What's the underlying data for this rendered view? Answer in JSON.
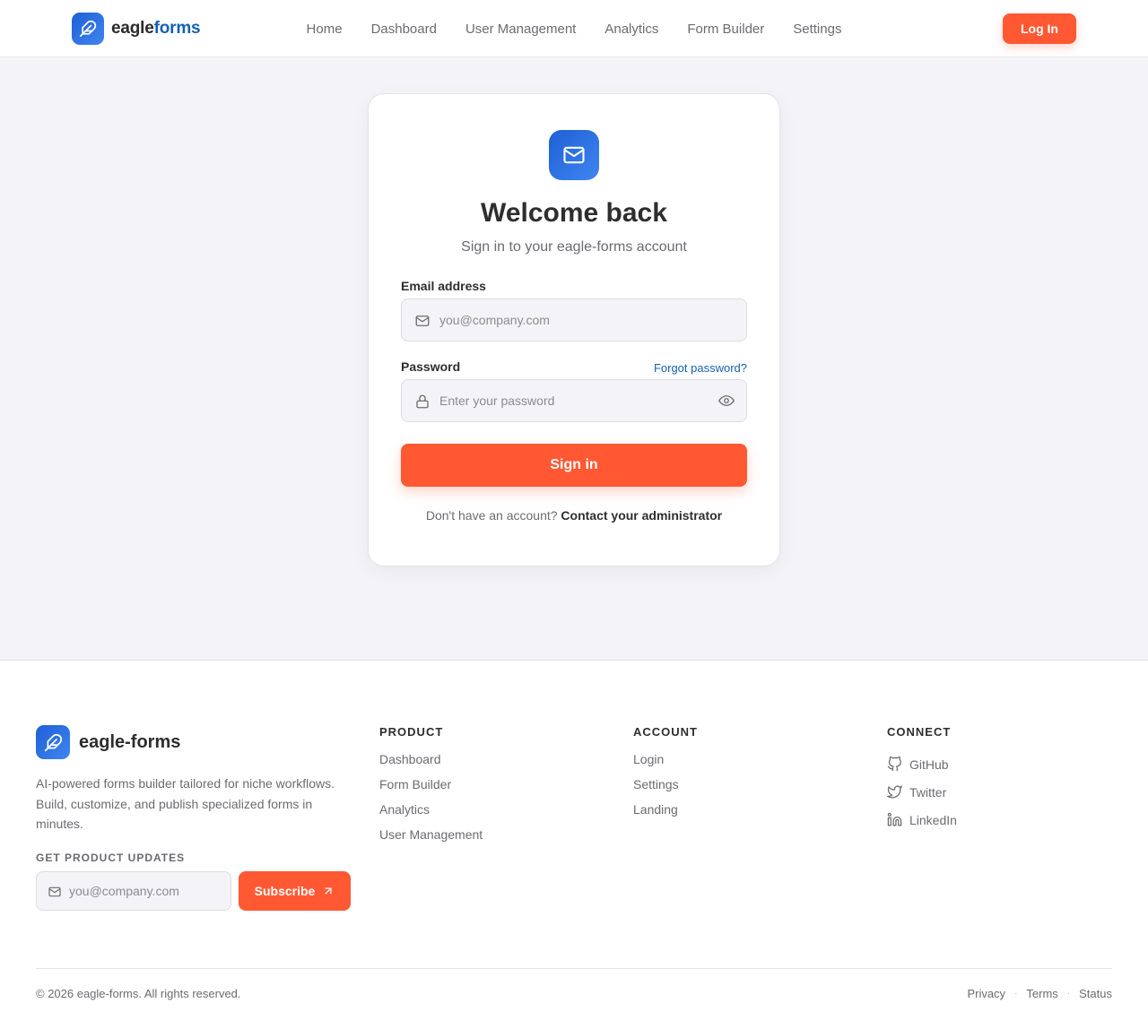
{
  "header": {
    "brand_part1": "eagle",
    "brand_part2": "forms",
    "nav": [
      "Home",
      "Dashboard",
      "User Management",
      "Analytics",
      "Form Builder",
      "Settings"
    ],
    "login_label": "Log In"
  },
  "login_card": {
    "icon": "mail-icon",
    "title": "Welcome back",
    "subtitle": "Sign in to your eagle-forms account",
    "email_label": "Email address",
    "email_placeholder": "you@company.com",
    "password_label": "Password",
    "forgot_label": "Forgot password?",
    "password_placeholder": "Enter your password",
    "signin_label": "Sign in",
    "no_account_text": "Don't have an account?",
    "contact_link": "Contact your administrator"
  },
  "footer": {
    "brand": "eagle-forms",
    "description": "AI-powered forms builder tailored for niche workflows. Build, customize, and publish specialized forms in minutes.",
    "updates_heading": "GET PRODUCT UPDATES",
    "subscribe_placeholder": "you@company.com",
    "subscribe_label": "Subscribe",
    "product": {
      "heading": "PRODUCT",
      "links": [
        "Dashboard",
        "Form Builder",
        "Analytics",
        "User Management"
      ]
    },
    "account": {
      "heading": "ACCOUNT",
      "links": [
        "Login",
        "Settings",
        "Landing"
      ]
    },
    "connect": {
      "heading": "CONNECT",
      "links": [
        "GitHub",
        "Twitter",
        "LinkedIn"
      ]
    },
    "copyright": "© 2026 eagle-forms. All rights reserved.",
    "legal": [
      "Privacy",
      "Terms",
      "Status"
    ]
  },
  "colors": {
    "accent": "#ff5833",
    "brand_blue": "#1561b3",
    "logo_gradient_start": "#1f5fd6",
    "logo_gradient_end": "#3f86f0",
    "page_background": "#f4f4f8"
  }
}
